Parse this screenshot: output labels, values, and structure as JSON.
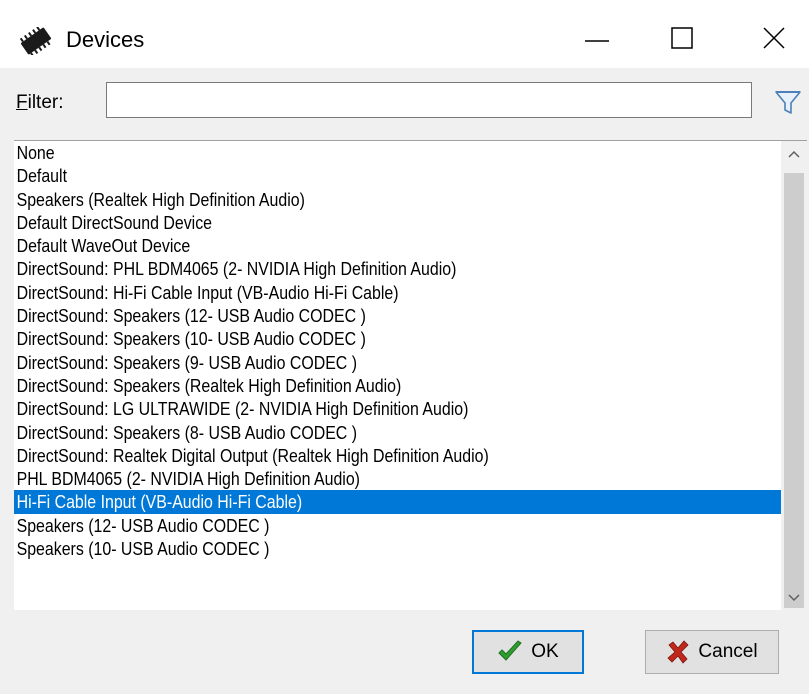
{
  "window": {
    "title": "Devices",
    "icon": "chip-icon",
    "controls": [
      "minimize-icon",
      "maximize-icon",
      "close-icon"
    ]
  },
  "filter": {
    "label_underlined": "F",
    "label_rest": "ilter:",
    "value": "",
    "icon": "funnel-icon"
  },
  "list": {
    "items": [
      "None",
      "Default",
      "Speakers (Realtek High Definition Audio)",
      "Default DirectSound Device",
      "Default WaveOut Device",
      "DirectSound: PHL BDM4065 (2- NVIDIA High Definition Audio)",
      "DirectSound: Hi-Fi Cable Input (VB-Audio Hi-Fi Cable)",
      "DirectSound: Speakers (12- USB Audio CODEC )",
      "DirectSound: Speakers (10- USB Audio CODEC )",
      "DirectSound: Speakers (9- USB Audio CODEC )",
      "DirectSound: Speakers (Realtek High Definition Audio)",
      "DirectSound: LG ULTRAWIDE (2- NVIDIA High Definition Audio)",
      "DirectSound: Speakers (8- USB Audio CODEC )",
      "DirectSound: Realtek Digital Output (Realtek High Definition Audio)",
      "PHL BDM4065 (2- NVIDIA High Definition Audio)",
      "Hi-Fi Cable Input (VB-Audio Hi-Fi Cable)",
      "Speakers (12- USB Audio CODEC )",
      "Speakers (10- USB Audio CODEC )"
    ],
    "selected_index": 15,
    "selection_color": "#0078d7"
  },
  "buttons": {
    "ok_label": "OK",
    "ok_icon": "checkmark-icon",
    "ok_icon_color": "#2e9e2e",
    "cancel_label": "Cancel",
    "cancel_icon": "x-mark-icon",
    "cancel_icon_color": "#c0281b"
  }
}
